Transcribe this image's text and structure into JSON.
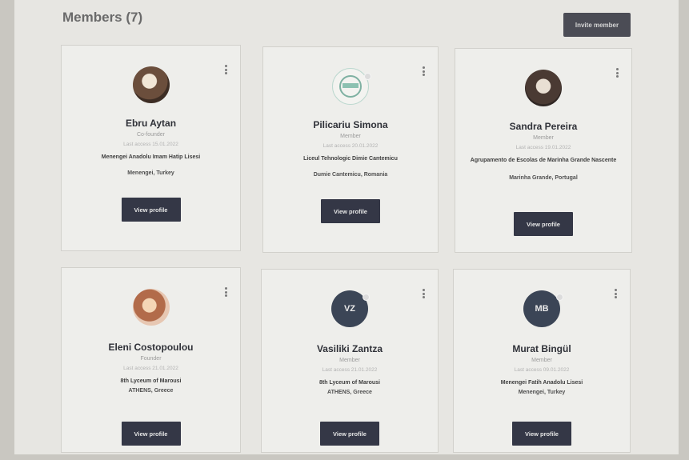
{
  "header": {
    "title": "Members (7)",
    "invite_label": "Invite member"
  },
  "members": [
    {
      "name": "Ebru Aytan",
      "role": "Co-founder",
      "last_access": "Last access 15.01.2022",
      "org": "Menengei Anadolu Imam Hatip Lisesi",
      "place": "Menengei, Turkey",
      "avatar_type": "photo",
      "view_label": "View profile"
    },
    {
      "name": "Pilicariu Simona",
      "role": "Member",
      "last_access": "Last access 20.01.2022",
      "org": "Liceul Tehnologic Dimie Cantemicu",
      "place": "Dumie Cantemicu, Romania",
      "avatar_type": "logo",
      "view_label": "View profile"
    },
    {
      "name": "Sandra Pereira",
      "role": "Member",
      "last_access": "Last access 19.01.2022",
      "org": "Agrupamento de Escolas de Marinha Grande Nascente",
      "place": "Marinha Grande, Portugal",
      "avatar_type": "photo",
      "view_label": "View profile"
    },
    {
      "name": "Eleni Costopoulou",
      "role": "Founder",
      "last_access": "Last access 21.01.2022",
      "org": "8th Lyceum of Marousi",
      "place": "ATHENS, Greece",
      "avatar_type": "photo",
      "view_label": "View profile"
    },
    {
      "name": "Vasiliki Zantza",
      "role": "Member",
      "last_access": "Last access 21.01.2022",
      "org": "8th Lyceum of Marousi",
      "place": "ATHENS, Greece",
      "avatar_type": "initials",
      "initials": "VZ",
      "view_label": "View profile"
    },
    {
      "name": "Murat Bingül",
      "role": "Member",
      "last_access": "Last access 09.01.2022",
      "org": "Menengei Fatih Anadolu Lisesi",
      "place": "Menengei, Turkey",
      "avatar_type": "initials",
      "initials": "MB",
      "view_label": "View profile"
    }
  ],
  "colors": {
    "button_bg": "#343746",
    "avatar_bg": "#3b4556",
    "card_bg": "#eeeeeb",
    "page_bg": "#e7e6e2"
  },
  "icons": {
    "card_menu": "kebab-menu-icon",
    "role": "user-icon"
  }
}
